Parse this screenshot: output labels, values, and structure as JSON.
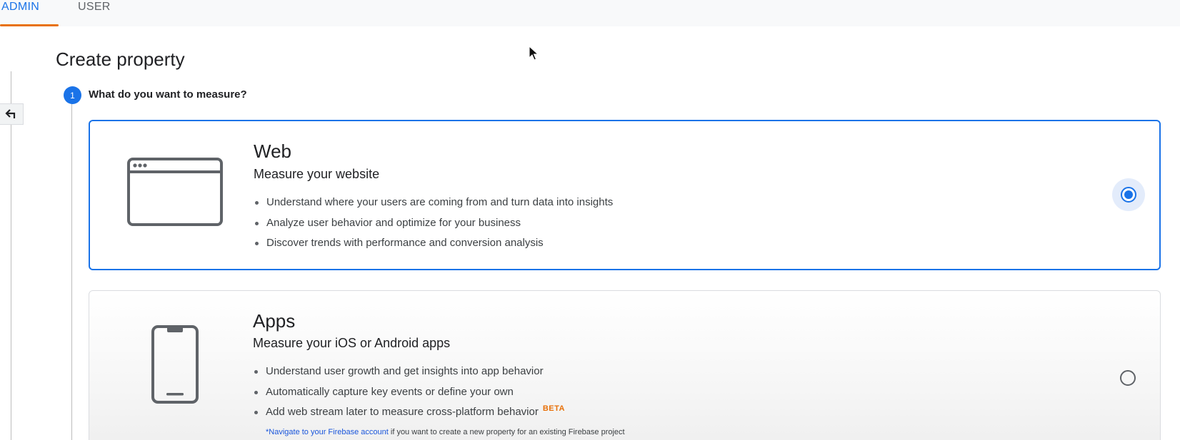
{
  "tabs": [
    {
      "label": "ADMIN",
      "active": true
    },
    {
      "label": "USER",
      "active": false
    }
  ],
  "page": {
    "title": "Create property"
  },
  "step": {
    "number": "1",
    "title": "What do you want to measure?"
  },
  "options": {
    "web": {
      "heading": "Web",
      "subtitle": "Measure your website",
      "bullets": [
        "Understand where your users are coming from and turn data into insights",
        "Analyze user behavior and optimize for your business",
        "Discover trends with performance and conversion analysis"
      ],
      "selected": true,
      "icon": "browser-window-icon"
    },
    "apps": {
      "heading": "Apps",
      "subtitle": "Measure your iOS or Android apps",
      "bullets": [
        "Understand user growth and get insights into app behavior",
        "Automatically capture key events or define your own",
        "Add web stream later to measure cross-platform behavior"
      ],
      "badge": "BETA",
      "note_link": "*Navigate to your Firebase account",
      "note_text": " if you want to create a new property for an existing Firebase project",
      "selected": false,
      "icon": "smartphone-icon"
    }
  },
  "colors": {
    "accent": "#1a73e8",
    "tab_underline": "#e8710a",
    "beta": "#e8710a"
  }
}
